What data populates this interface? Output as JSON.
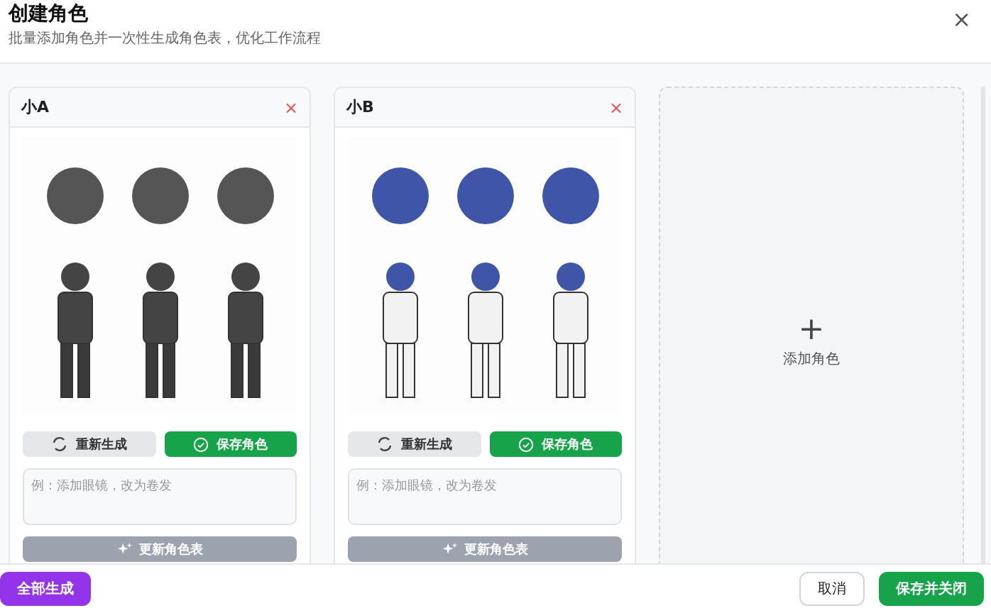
{
  "dialog": {
    "title": "创建角色",
    "subtitle": "批量添加角色并一次性生成角色表，优化工作流程",
    "close": "×"
  },
  "characters": [
    {
      "name": "小A",
      "remove": "×",
      "regenerate": "重新生成",
      "save": "保存角色",
      "prompt_placeholder": "例：添加眼镜，改为卷发",
      "update": "更新角色表"
    },
    {
      "name": "小B",
      "remove": "×",
      "regenerate": "重新生成",
      "save": "保存角色",
      "prompt_placeholder": "例：添加眼镜，改为卷发",
      "update": "更新角色表"
    }
  ],
  "add_card": {
    "icon": "+",
    "label": "添加角色"
  },
  "footer": {
    "generate_all": "全部生成",
    "cancel": "取消",
    "save_close": "保存并关闭"
  }
}
